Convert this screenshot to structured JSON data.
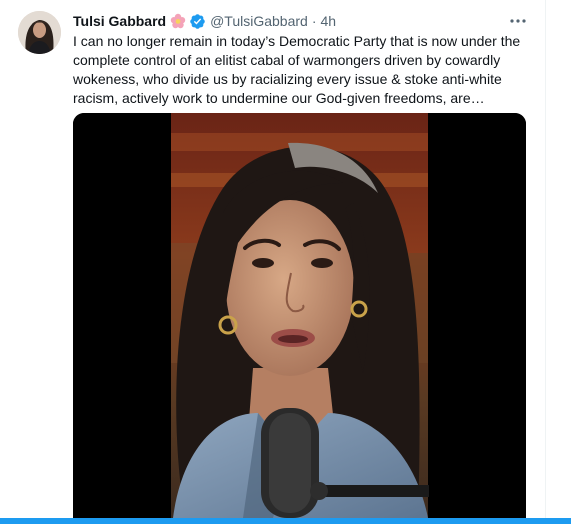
{
  "tweet": {
    "author_name": "Tulsi Gabbard",
    "name_emoji": "flower-emoji",
    "verified": true,
    "handle": "@TulsiGabbard",
    "separator": "·",
    "timestamp": "4h",
    "text": "I can no longer remain in today’s Democratic Party that is now under the\ncomplete control of an elitist cabal of warmongers driven by cowardly\nwokeness, who divide us by racializing every issue & stoke anti-white\nracism, actively work to undermine our God-given freedoms, are…",
    "more_icon": "more-horizontal-icon",
    "media": {
      "type": "video",
      "subject": "video-still"
    }
  },
  "colors": {
    "text": "#0f1419",
    "secondary": "#536471",
    "verified": "#1d9bf0",
    "accent_bar": "#1d9bf0",
    "media_background": "#000000"
  }
}
